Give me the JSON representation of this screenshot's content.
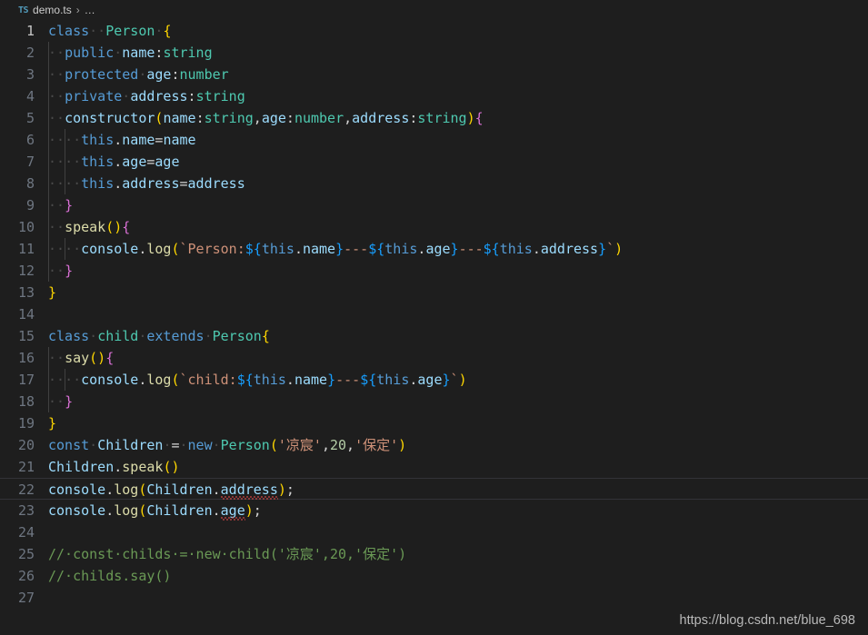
{
  "breadcrumb": {
    "file_icon_label": "TS",
    "file_name": "demo.ts",
    "separator": "›",
    "overflow": "…"
  },
  "watermark": {
    "text": "https://blog.csdn.net/blue_698"
  },
  "editor": {
    "language": "typescript",
    "active_line": 22,
    "cursor_line": 1,
    "total_lines": 27,
    "colors": {
      "background": "#1e1e1e",
      "line_number": "#6e7681",
      "line_number_active": "#c6c6c6",
      "keyword": "#569cd6",
      "type": "#4ec9b0",
      "variable": "#9cdcfe",
      "function": "#dcdcaa",
      "string": "#ce9178",
      "number": "#b5cea8",
      "comment": "#6a9955",
      "operator": "#d4d4d4",
      "bracket_1": "#ffd700",
      "bracket_2": "#da70d6",
      "bracket_3": "#179fff",
      "error_squiggle": "#f14c4c",
      "indent_guide": "#404040",
      "active_line_border": "#333338"
    },
    "lines": [
      {
        "n": "1",
        "indent": 0,
        "tokens": [
          {
            "t": "class",
            "c": "kw"
          },
          {
            "t": "··",
            "c": "ws"
          },
          {
            "t": "Person",
            "c": "type"
          },
          {
            "t": "·",
            "c": "ws"
          },
          {
            "t": "{",
            "c": "b1"
          }
        ]
      },
      {
        "n": "2",
        "indent": 1,
        "tokens": [
          {
            "t": "··",
            "c": "ws"
          },
          {
            "t": "public",
            "c": "kw"
          },
          {
            "t": "·",
            "c": "ws"
          },
          {
            "t": "name",
            "c": "var"
          },
          {
            "t": ":",
            "c": "op"
          },
          {
            "t": "string",
            "c": "type"
          }
        ]
      },
      {
        "n": "3",
        "indent": 1,
        "tokens": [
          {
            "t": "··",
            "c": "ws"
          },
          {
            "t": "protected",
            "c": "kw"
          },
          {
            "t": "·",
            "c": "ws"
          },
          {
            "t": "age",
            "c": "var"
          },
          {
            "t": ":",
            "c": "op"
          },
          {
            "t": "number",
            "c": "type"
          }
        ]
      },
      {
        "n": "4",
        "indent": 1,
        "tokens": [
          {
            "t": "··",
            "c": "ws"
          },
          {
            "t": "private",
            "c": "kw"
          },
          {
            "t": "·",
            "c": "ws"
          },
          {
            "t": "address",
            "c": "var"
          },
          {
            "t": ":",
            "c": "op"
          },
          {
            "t": "string",
            "c": "type"
          }
        ]
      },
      {
        "n": "5",
        "indent": 1,
        "tokens": [
          {
            "t": "··",
            "c": "ws"
          },
          {
            "t": "constructor",
            "c": "var"
          },
          {
            "t": "(",
            "c": "b1"
          },
          {
            "t": "name",
            "c": "var"
          },
          {
            "t": ":",
            "c": "op"
          },
          {
            "t": "string",
            "c": "type"
          },
          {
            "t": ",",
            "c": "op"
          },
          {
            "t": "age",
            "c": "var"
          },
          {
            "t": ":",
            "c": "op"
          },
          {
            "t": "number",
            "c": "type"
          },
          {
            "t": ",",
            "c": "op"
          },
          {
            "t": "address",
            "c": "var"
          },
          {
            "t": ":",
            "c": "op"
          },
          {
            "t": "string",
            "c": "type"
          },
          {
            "t": ")",
            "c": "b1"
          },
          {
            "t": "{",
            "c": "b2"
          }
        ]
      },
      {
        "n": "6",
        "indent": 2,
        "tokens": [
          {
            "t": "··",
            "c": "ws"
          },
          {
            "t": "··",
            "c": "ws"
          },
          {
            "t": "this",
            "c": "kw"
          },
          {
            "t": ".",
            "c": "op"
          },
          {
            "t": "name",
            "c": "var"
          },
          {
            "t": "=",
            "c": "op"
          },
          {
            "t": "name",
            "c": "var"
          }
        ]
      },
      {
        "n": "7",
        "indent": 2,
        "tokens": [
          {
            "t": "··",
            "c": "ws"
          },
          {
            "t": "··",
            "c": "ws"
          },
          {
            "t": "this",
            "c": "kw"
          },
          {
            "t": ".",
            "c": "op"
          },
          {
            "t": "age",
            "c": "var"
          },
          {
            "t": "=",
            "c": "op"
          },
          {
            "t": "age",
            "c": "var"
          }
        ]
      },
      {
        "n": "8",
        "indent": 2,
        "tokens": [
          {
            "t": "··",
            "c": "ws"
          },
          {
            "t": "··",
            "c": "ws"
          },
          {
            "t": "this",
            "c": "kw"
          },
          {
            "t": ".",
            "c": "op"
          },
          {
            "t": "address",
            "c": "var"
          },
          {
            "t": "=",
            "c": "op"
          },
          {
            "t": "address",
            "c": "var"
          }
        ]
      },
      {
        "n": "9",
        "indent": 1,
        "tokens": [
          {
            "t": "··",
            "c": "ws"
          },
          {
            "t": "}",
            "c": "b2"
          }
        ]
      },
      {
        "n": "10",
        "indent": 1,
        "tokens": [
          {
            "t": "··",
            "c": "ws"
          },
          {
            "t": "speak",
            "c": "fn"
          },
          {
            "t": "()",
            "c": "b1"
          },
          {
            "t": "{",
            "c": "b2"
          }
        ]
      },
      {
        "n": "11",
        "indent": 2,
        "tokens": [
          {
            "t": "··",
            "c": "ws"
          },
          {
            "t": "··",
            "c": "ws"
          },
          {
            "t": "console",
            "c": "var"
          },
          {
            "t": ".",
            "c": "op"
          },
          {
            "t": "log",
            "c": "fn"
          },
          {
            "t": "(",
            "c": "b1"
          },
          {
            "t": "`",
            "c": "str"
          },
          {
            "t": "Person:",
            "c": "str"
          },
          {
            "t": "${",
            "c": "b3"
          },
          {
            "t": "this",
            "c": "kw"
          },
          {
            "t": ".",
            "c": "op"
          },
          {
            "t": "name",
            "c": "var"
          },
          {
            "t": "}",
            "c": "b3"
          },
          {
            "t": "---",
            "c": "str"
          },
          {
            "t": "${",
            "c": "b3"
          },
          {
            "t": "this",
            "c": "kw"
          },
          {
            "t": ".",
            "c": "op"
          },
          {
            "t": "age",
            "c": "var"
          },
          {
            "t": "}",
            "c": "b3"
          },
          {
            "t": "---",
            "c": "str"
          },
          {
            "t": "${",
            "c": "b3"
          },
          {
            "t": "this",
            "c": "kw"
          },
          {
            "t": ".",
            "c": "op"
          },
          {
            "t": "address",
            "c": "var"
          },
          {
            "t": "}",
            "c": "b3"
          },
          {
            "t": "`",
            "c": "str"
          },
          {
            "t": ")",
            "c": "b1"
          }
        ]
      },
      {
        "n": "12",
        "indent": 1,
        "tokens": [
          {
            "t": "··",
            "c": "ws"
          },
          {
            "t": "}",
            "c": "b2"
          }
        ]
      },
      {
        "n": "13",
        "indent": 0,
        "tokens": [
          {
            "t": "}",
            "c": "b1"
          }
        ]
      },
      {
        "n": "14",
        "indent": 0,
        "tokens": []
      },
      {
        "n": "15",
        "indent": 0,
        "tokens": [
          {
            "t": "class",
            "c": "kw"
          },
          {
            "t": "·",
            "c": "ws"
          },
          {
            "t": "child",
            "c": "type"
          },
          {
            "t": "·",
            "c": "ws"
          },
          {
            "t": "extends",
            "c": "kw"
          },
          {
            "t": "·",
            "c": "ws"
          },
          {
            "t": "Person",
            "c": "type"
          },
          {
            "t": "{",
            "c": "b1"
          }
        ]
      },
      {
        "n": "16",
        "indent": 1,
        "tokens": [
          {
            "t": "··",
            "c": "ws"
          },
          {
            "t": "say",
            "c": "fn"
          },
          {
            "t": "()",
            "c": "b1"
          },
          {
            "t": "{",
            "c": "b2"
          }
        ]
      },
      {
        "n": "17",
        "indent": 2,
        "tokens": [
          {
            "t": "··",
            "c": "ws"
          },
          {
            "t": "··",
            "c": "ws"
          },
          {
            "t": "console",
            "c": "var"
          },
          {
            "t": ".",
            "c": "op"
          },
          {
            "t": "log",
            "c": "fn"
          },
          {
            "t": "(",
            "c": "b1"
          },
          {
            "t": "`",
            "c": "str"
          },
          {
            "t": "child:",
            "c": "str"
          },
          {
            "t": "${",
            "c": "b3"
          },
          {
            "t": "this",
            "c": "kw"
          },
          {
            "t": ".",
            "c": "op"
          },
          {
            "t": "name",
            "c": "var"
          },
          {
            "t": "}",
            "c": "b3"
          },
          {
            "t": "---",
            "c": "str"
          },
          {
            "t": "${",
            "c": "b3"
          },
          {
            "t": "this",
            "c": "kw"
          },
          {
            "t": ".",
            "c": "op"
          },
          {
            "t": "age",
            "c": "var"
          },
          {
            "t": "}",
            "c": "b3"
          },
          {
            "t": "`",
            "c": "str"
          },
          {
            "t": ")",
            "c": "b1"
          }
        ]
      },
      {
        "n": "18",
        "indent": 1,
        "tokens": [
          {
            "t": "··",
            "c": "ws"
          },
          {
            "t": "}",
            "c": "b2"
          }
        ]
      },
      {
        "n": "19",
        "indent": 0,
        "tokens": [
          {
            "t": "}",
            "c": "b1"
          }
        ]
      },
      {
        "n": "20",
        "indent": 0,
        "tokens": [
          {
            "t": "const",
            "c": "kw"
          },
          {
            "t": "·",
            "c": "ws"
          },
          {
            "t": "Children",
            "c": "var"
          },
          {
            "t": "·",
            "c": "ws"
          },
          {
            "t": "=",
            "c": "op"
          },
          {
            "t": "·",
            "c": "ws"
          },
          {
            "t": "new",
            "c": "kw"
          },
          {
            "t": "·",
            "c": "ws"
          },
          {
            "t": "Person",
            "c": "type"
          },
          {
            "t": "(",
            "c": "b1"
          },
          {
            "t": "'凉宸'",
            "c": "str"
          },
          {
            "t": ",",
            "c": "op"
          },
          {
            "t": "20",
            "c": "num"
          },
          {
            "t": ",",
            "c": "op"
          },
          {
            "t": "'保定'",
            "c": "str"
          },
          {
            "t": ")",
            "c": "b1"
          }
        ]
      },
      {
        "n": "21",
        "indent": 0,
        "tokens": [
          {
            "t": "Children",
            "c": "var"
          },
          {
            "t": ".",
            "c": "op"
          },
          {
            "t": "speak",
            "c": "fn"
          },
          {
            "t": "()",
            "c": "b1"
          }
        ]
      },
      {
        "n": "22",
        "indent": 0,
        "active": true,
        "tokens": [
          {
            "t": "console",
            "c": "var"
          },
          {
            "t": ".",
            "c": "op"
          },
          {
            "t": "log",
            "c": "fn"
          },
          {
            "t": "(",
            "c": "b1"
          },
          {
            "t": "Children",
            "c": "var"
          },
          {
            "t": ".",
            "c": "op"
          },
          {
            "t": "address",
            "c": "var",
            "err": true
          },
          {
            "t": ")",
            "c": "b1"
          },
          {
            "t": ";",
            "c": "op"
          }
        ]
      },
      {
        "n": "23",
        "indent": 0,
        "tokens": [
          {
            "t": "console",
            "c": "var"
          },
          {
            "t": ".",
            "c": "op"
          },
          {
            "t": "log",
            "c": "fn"
          },
          {
            "t": "(",
            "c": "b1"
          },
          {
            "t": "Children",
            "c": "var"
          },
          {
            "t": ".",
            "c": "op"
          },
          {
            "t": "age",
            "c": "var",
            "err": true
          },
          {
            "t": ")",
            "c": "b1"
          },
          {
            "t": ";",
            "c": "op"
          }
        ]
      },
      {
        "n": "24",
        "indent": 0,
        "tokens": []
      },
      {
        "n": "25",
        "indent": 0,
        "tokens": [
          {
            "t": "//·const·childs·=·new·child('凉宸',20,'保定')",
            "c": "cmt"
          }
        ]
      },
      {
        "n": "26",
        "indent": 0,
        "tokens": [
          {
            "t": "//·childs.say()",
            "c": "cmt"
          }
        ]
      },
      {
        "n": "27",
        "indent": 0,
        "tokens": []
      }
    ]
  }
}
